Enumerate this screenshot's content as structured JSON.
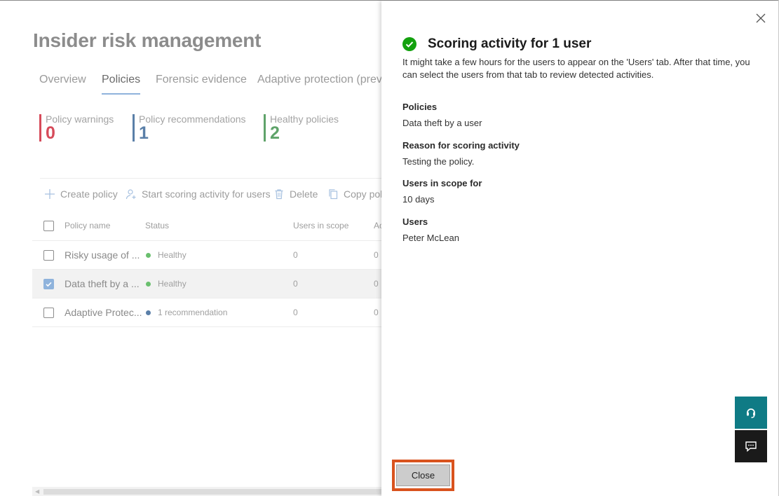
{
  "page": {
    "title": "Insider risk management"
  },
  "tabs": [
    {
      "label": "Overview"
    },
    {
      "label": "Policies"
    },
    {
      "label": "Forensic evidence"
    },
    {
      "label": "Adaptive protection (previ"
    }
  ],
  "stats": [
    {
      "label": "Policy warnings",
      "value": "0",
      "color": "#d64b5a"
    },
    {
      "label": "Policy recommendations",
      "value": "1",
      "color": "#5a7fa8"
    },
    {
      "label": "Healthy policies",
      "value": "2",
      "color": "#5fa36a"
    }
  ],
  "toolbar": {
    "create": "Create policy",
    "scoring": "Start scoring activity for users",
    "delete": "Delete",
    "copy": "Copy pol"
  },
  "table": {
    "columns": [
      "Policy name",
      "Status",
      "Users in scope",
      "Ac"
    ],
    "rows": [
      {
        "name": "Risky usage of ...",
        "status": "Healthy",
        "status_color": "#6abf6e",
        "users": "0",
        "extra": "0",
        "checked": false
      },
      {
        "name": "Data theft by a ...",
        "status": "Healthy",
        "status_color": "#6abf6e",
        "users": "0",
        "extra": "0",
        "checked": true
      },
      {
        "name": "Adaptive Protec...",
        "status": "1 recommendation",
        "status_color": "#5a7fa8",
        "users": "0",
        "extra": "0",
        "checked": false
      }
    ]
  },
  "panel": {
    "title": "Scoring activity for 1 user",
    "description": "It might take a few hours for the users to appear on the 'Users' tab. After that time, you can select the users from that tab to review detected activities.",
    "fields": [
      {
        "label": "Policies",
        "value": "Data theft by a user"
      },
      {
        "label": "Reason for scoring activity",
        "value": "Testing the policy."
      },
      {
        "label": "Users in scope for",
        "value": "10 days"
      },
      {
        "label": "Users",
        "value": "Peter McLean"
      }
    ],
    "close_label": "Close",
    "icons": {
      "success": "check-circle-icon",
      "dismiss": "close-icon",
      "help": "headset-icon",
      "feedback": "feedback-icon"
    }
  },
  "colors": {
    "accent": "#0f7b85",
    "success": "#13a10e",
    "highlight": "#d9531e"
  }
}
